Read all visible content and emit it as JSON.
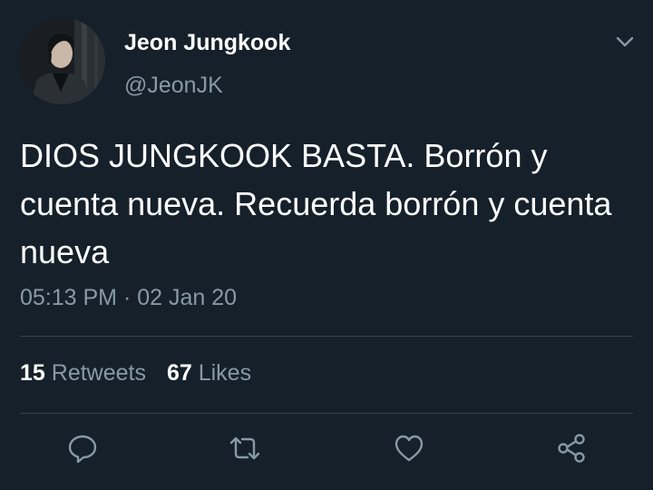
{
  "user": {
    "display_name": "Jeon Jungkook",
    "handle": "@JeonJK",
    "avatar_icon": "profile-photo"
  },
  "tweet": {
    "text": "DIOS JUNGKOOK BASTA. Borrón y cuenta nueva. Recuerda borrón y cuenta nueva",
    "time": "05:13 PM",
    "separator": "·",
    "date": "02 Jan 20"
  },
  "stats": {
    "retweets_count": "15",
    "retweets_label": "Retweets",
    "likes_count": "67",
    "likes_label": "Likes"
  },
  "actions": {
    "icons": [
      "reply-icon",
      "retweet-icon",
      "like-icon",
      "share-icon"
    ]
  },
  "colors": {
    "background": "#15202b",
    "primary_text": "#ffffff",
    "secondary_text": "#8899a6",
    "divider": "#38444d"
  }
}
